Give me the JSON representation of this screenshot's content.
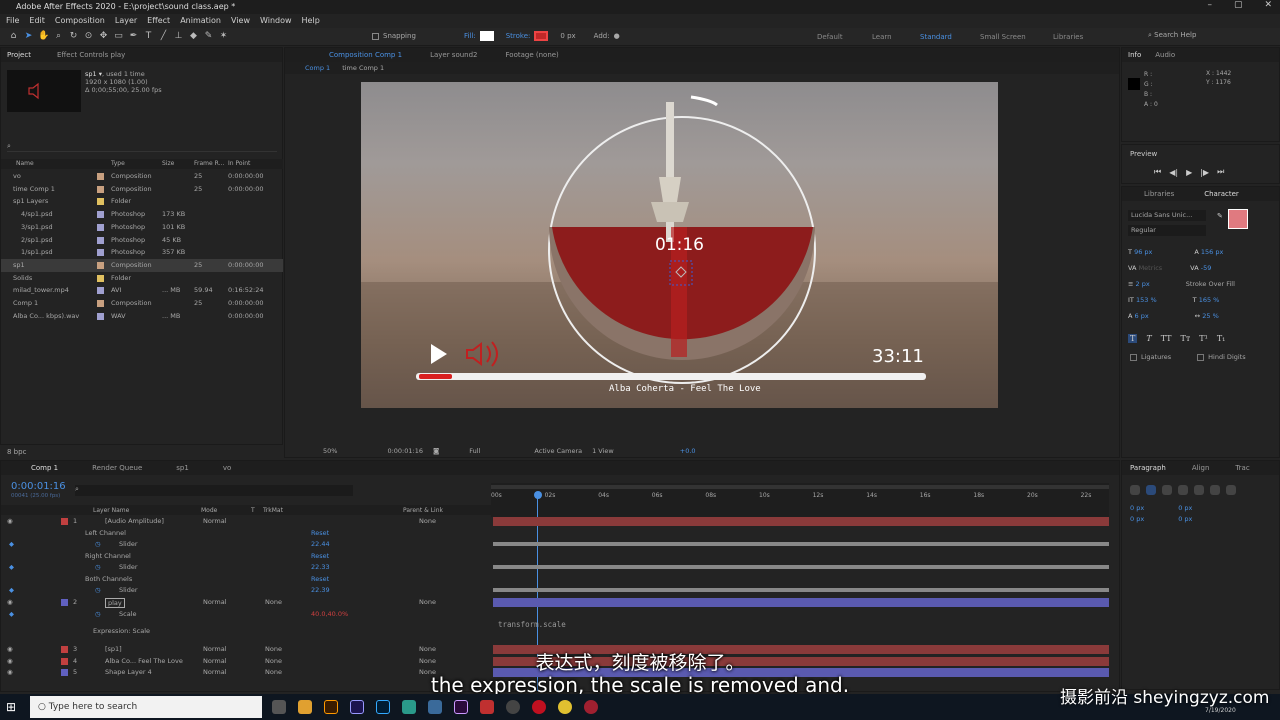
{
  "window": {
    "title": "Adobe After Effects 2020 - E:\\project\\sound class.aep *"
  },
  "menu": [
    "File",
    "Edit",
    "Composition",
    "Layer",
    "Effect",
    "Animation",
    "View",
    "Window",
    "Help"
  ],
  "toolbar": {
    "snapping": "Snapping",
    "fill": "Fill:",
    "stroke": "Stroke:",
    "stroke_px": "0 px",
    "add": "Add:"
  },
  "workspaces": [
    "Default",
    "Learn",
    "Standard",
    "Small Screen",
    "Libraries"
  ],
  "search_help": "Search Help",
  "project": {
    "tab_project": "Project",
    "tab_effect": "Effect Controls play",
    "selected_name": "sp1 ▾",
    "used": ", used 1 time",
    "dims": "1920 x 1080 (1.00)",
    "dur": "Δ 0;00;55;00, 25.00 fps",
    "cols": {
      "name": "Name",
      "type": "Type",
      "size": "Size",
      "frame": "Frame R...",
      "inpoint": "In Point"
    },
    "rows": [
      {
        "name": "vo",
        "type": "Composition",
        "size": "",
        "fr": "25",
        "ip": "0:00:00:00",
        "color": "#c8a080"
      },
      {
        "name": "time Comp 1",
        "type": "Composition",
        "size": "",
        "fr": "25",
        "ip": "0:00:00:00",
        "color": "#c8a080"
      },
      {
        "name": "sp1 Layers",
        "type": "Folder",
        "size": "",
        "fr": "",
        "ip": "",
        "color": "#e0c060"
      },
      {
        "name": "4/sp1.psd",
        "type": "Photoshop",
        "size": "173 KB",
        "fr": "",
        "ip": "",
        "color": "#a0a0d0"
      },
      {
        "name": "3/sp1.psd",
        "type": "Photoshop",
        "size": "101 KB",
        "fr": "",
        "ip": "",
        "color": "#a0a0d0"
      },
      {
        "name": "2/sp1.psd",
        "type": "Photoshop",
        "size": "45 KB",
        "fr": "",
        "ip": "",
        "color": "#a0a0d0"
      },
      {
        "name": "1/sp1.psd",
        "type": "Photoshop",
        "size": "357 KB",
        "fr": "",
        "ip": "",
        "color": "#a0a0d0"
      },
      {
        "name": "sp1",
        "type": "Composition",
        "size": "",
        "fr": "25",
        "ip": "0:00:00:00",
        "color": "#c8a080"
      },
      {
        "name": "Solids",
        "type": "Folder",
        "size": "",
        "fr": "",
        "ip": "",
        "color": "#e0c060"
      },
      {
        "name": "milad_tower.mp4",
        "type": "AVI",
        "size": "... MB",
        "fr": "59.94",
        "ip": "0:16:52:24",
        "color": "#a0a0d0"
      },
      {
        "name": "Comp 1",
        "type": "Composition",
        "size": "",
        "fr": "25",
        "ip": "0:00:00:00",
        "color": "#c8a080"
      },
      {
        "name": "Alba Co... kbps).wav",
        "type": "WAV",
        "size": "... MB",
        "fr": "",
        "ip": "0:00:00:00",
        "color": "#a0a0d0"
      }
    ],
    "bpc": "8 bpc"
  },
  "comp": {
    "tab": "Composition Comp 1",
    "layer_tab": "Layer sound2",
    "footage_tab": "Footage (none)",
    "breadcrumbs": [
      "Comp 1",
      "time Comp 1"
    ],
    "time_display": "01:16",
    "total_time": "33:11",
    "song": "Alba Coherta - Feel The Love",
    "zoom": "50%",
    "timecode": "0:00:01:16",
    "resolution": "Full",
    "camera": "Active Camera",
    "view": "1 View",
    "exposure": "+0.0"
  },
  "info": {
    "tab_info": "Info",
    "tab_audio": "Audio",
    "r": "R :",
    "g": "G :",
    "b": "B :",
    "a": "A :  0",
    "x": "X : 1442",
    "y": "Y : 1176"
  },
  "preview": {
    "title": "Preview"
  },
  "character": {
    "tab_lib": "Libraries",
    "tab_char": "Character",
    "font": "Lucida Sans Unic...",
    "style": "Regular",
    "size": "96 px",
    "leading": "156 px",
    "tracking": "-59",
    "kerning": "Metrics",
    "stroke": "2 px",
    "stroke_mode": "Stroke Over Fill",
    "vscale": "153 %",
    "hscale": "165 %",
    "baseline": "6 px",
    "tsume": "25 %",
    "ligatures": "Ligatures",
    "hindi": "Hindi Digits",
    "text_color": "#e07a80"
  },
  "paragraph": {
    "tab_para": "Paragraph",
    "tab_align": "Align",
    "tab_track": "Trac",
    "v1": "0 px",
    "v2": "0 px",
    "v3": "0 px",
    "v4": "0 px",
    "v5": "0 px"
  },
  "timeline": {
    "tabs": [
      "Comp 1",
      "Render Queue",
      "sp1",
      "vo"
    ],
    "current_time": "0:00:01:16",
    "frame_info": "00041 (25.00 fps)",
    "cols": {
      "layer": "Layer Name",
      "mode": "Mode",
      "t": "T",
      "trkmat": "TrkMat",
      "parent": "Parent & Link"
    },
    "ruler": [
      "00s",
      "02s",
      "04s",
      "06s",
      "08s",
      "10s",
      "12s",
      "14s",
      "16s",
      "18s",
      "20s",
      "22s"
    ],
    "rows": [
      {
        "num": "1",
        "name": "[Audio Amplitude]",
        "mode": "Normal",
        "trk": "",
        "parent": "None",
        "color": "#c04040",
        "kind": "layer"
      },
      {
        "name": "Left Channel",
        "val": "Reset",
        "kind": "group"
      },
      {
        "name": "Slider",
        "val": "22.44",
        "kind": "prop"
      },
      {
        "name": "Right Channel",
        "val": "Reset",
        "kind": "group"
      },
      {
        "name": "Slider",
        "val": "22.33",
        "kind": "prop"
      },
      {
        "name": "Both Channels",
        "val": "Reset",
        "kind": "group"
      },
      {
        "name": "Slider",
        "val": "22.39",
        "kind": "prop"
      },
      {
        "num": "2",
        "name": "play",
        "mode": "Normal",
        "trk": "None",
        "parent": "None",
        "color": "#6060c0",
        "kind": "layer"
      },
      {
        "name": "Scale",
        "val": "40.0,40.0%",
        "kind": "prop"
      },
      {
        "name": "Expression: Scale",
        "val": "",
        "kind": "expr"
      },
      {
        "num": "3",
        "name": "[sp1]",
        "mode": "Normal",
        "trk": "None",
        "parent": "None",
        "color": "#c04040",
        "kind": "layer"
      },
      {
        "num": "4",
        "name": "Alba Co... Feel The Love",
        "mode": "Normal",
        "trk": "None",
        "parent": "None",
        "color": "#c04040",
        "kind": "layer"
      },
      {
        "num": "5",
        "name": "Shape Layer 4",
        "mode": "Normal",
        "trk": "None",
        "parent": "None",
        "color": "#6060c0",
        "kind": "layer"
      }
    ],
    "expression": "transform.scale"
  },
  "subtitle": {
    "zh": "表达式，刻度被移除了。",
    "en": "the expression, the scale is removed and."
  },
  "watermark": "摄影前沿 sheyingzyz.com",
  "taskbar": {
    "search": "Type here to search",
    "date": "7/19/2020"
  }
}
